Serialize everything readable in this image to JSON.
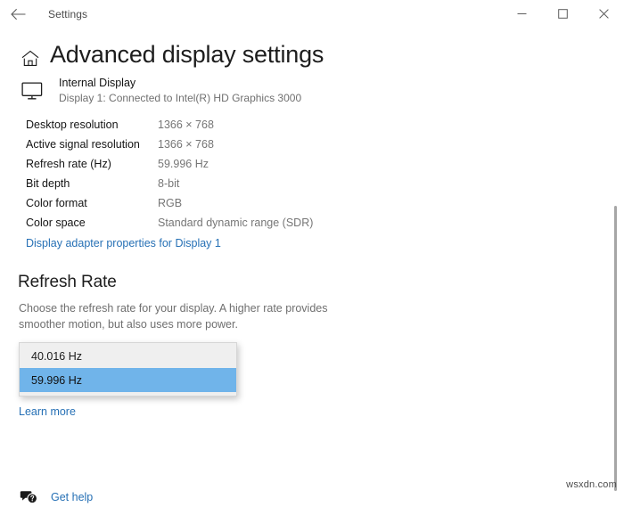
{
  "window": {
    "app_title": "Settings",
    "back_icon": "back-arrow-icon",
    "minimize_label": "─",
    "maximize_label": "☐",
    "close_label": "✕"
  },
  "page": {
    "home_icon": "home-icon",
    "title": "Advanced display settings"
  },
  "display": {
    "monitor_icon": "monitor-icon",
    "name": "Internal Display",
    "subtitle": "Display 1: Connected to Intel(R) HD Graphics 3000"
  },
  "details": [
    {
      "label": "Desktop resolution",
      "value": "1366 × 768"
    },
    {
      "label": "Active signal resolution",
      "value": "1366 × 768"
    },
    {
      "label": "Refresh rate (Hz)",
      "value": "59.996 Hz"
    },
    {
      "label": "Bit depth",
      "value": "8-bit"
    },
    {
      "label": "Color format",
      "value": "RGB"
    },
    {
      "label": "Color space",
      "value": "Standard dynamic range (SDR)"
    }
  ],
  "adapter_link": "Display adapter properties for Display 1",
  "refresh_rate": {
    "heading": "Refresh Rate",
    "description": "Choose the refresh rate for your display. A higher rate provides smoother motion, but also uses more power.",
    "options": [
      {
        "label": "40.016 Hz",
        "selected": false
      },
      {
        "label": "59.996 Hz",
        "selected": true
      }
    ],
    "selected_value": "59.996 Hz",
    "learn_more": "Learn more"
  },
  "footer": {
    "help_icon": "help-speech-bubble-icon",
    "help_label": "Get help"
  },
  "watermark": "wsxdn.com",
  "colors": {
    "link": "#2670b5",
    "selection": "#70b4ea",
    "dropdown_bg": "#efefef",
    "muted_text": "#767676"
  }
}
